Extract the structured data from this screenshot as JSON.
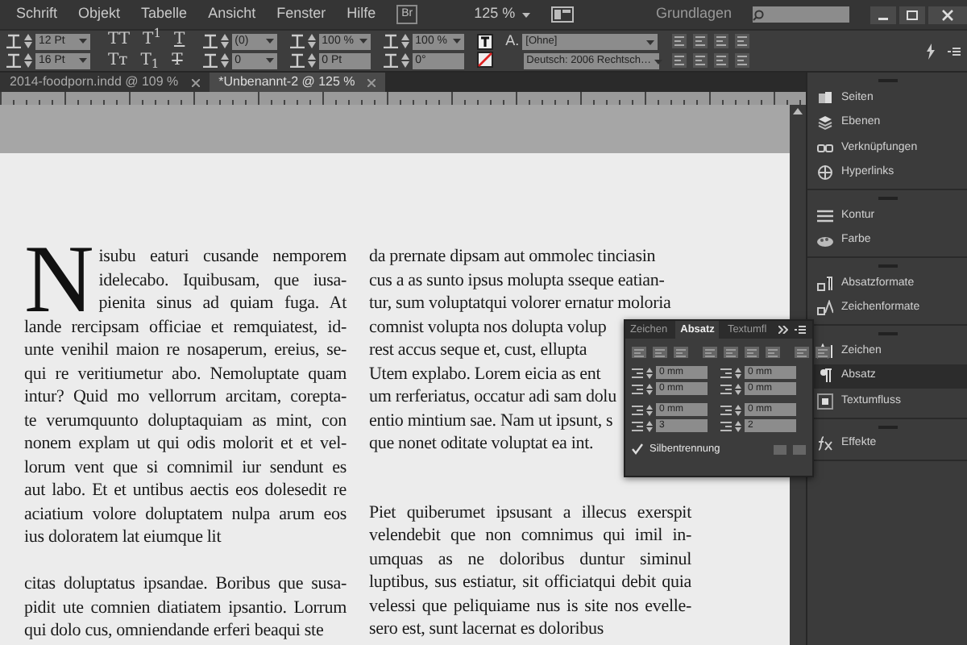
{
  "menu": [
    "Schrift",
    "Objekt",
    "Tabelle",
    "Ansicht",
    "Fenster",
    "Hilfe"
  ],
  "app_bar": {
    "bridge": "Br",
    "zoom": "125 %",
    "workspace": "Grundlagen"
  },
  "control_bar": {
    "size_fields": [
      {
        "value": "12 Pt",
        "dropdown": true
      },
      {
        "value": "16 Pt",
        "dropdown": true
      }
    ],
    "case_buttons": [
      {
        "text": "TT",
        "kind": "plain"
      },
      {
        "text": "T$^{1}$",
        "kind": "plain"
      },
      {
        "text": "T",
        "kind": "underline"
      },
      {
        "text": "Tᴛ",
        "kind": "plain"
      },
      {
        "text": "T$_{1}$",
        "kind": "plain"
      },
      {
        "text": "T",
        "kind": "strike"
      }
    ],
    "spacing_fields": [
      {
        "value": "(0)",
        "dropdown": true
      },
      {
        "value": "0",
        "dropdown": true
      }
    ],
    "scale_fields": [
      {
        "value": "100 %",
        "dropdown": true
      },
      {
        "value": "0 Pt",
        "dropdown": false
      }
    ],
    "skew_fields": [
      {
        "value": "100 %",
        "dropdown": true
      },
      {
        "value": "0°",
        "dropdown": false
      }
    ],
    "style_label": "A.",
    "style_menus": [
      "[Ohne]",
      "Deutsch: 2006 Rechtsch…"
    ]
  },
  "document_tabs": [
    {
      "label": "2014-foodporn.indd @ 109 %",
      "selected": false
    },
    {
      "label": "*Unbenannt-2 @ 125 %",
      "selected": true
    }
  ],
  "document": {
    "columns": [
      {
        "paragraphs": [
          {
            "drop_cap": "N",
            "justified": true,
            "lines": [
              "isubu eaturi cusande nemporem",
              "idelecabo. Iquibusam, que iusa-",
              "pienita sinus ad quiam fuga. At",
              "lande rercipsam officiae et remquiatest, id-",
              "unte venihil maion re nosaperum, ereius, se-",
              "qui re veritiumetur abo. Nemoluptate quam",
              "intur? Quid mo vellorrum arcitam, corepta-",
              "te verumquunto doluptaquiam as mint, con",
              "nonem explam ut qui odis molorit et et vel-",
              "lorum vent que si comnimil iur sendunt es",
              "aut labo. Et et untibus aectis eos dolesedit re",
              "aciatium volore doluptatem nulpa arum eos",
              "ius doloratem lat eiumque lit"
            ]
          },
          {
            "justified": true,
            "lines": [
              "citas doluptatus ipsandae. Boribus que susa-",
              "pidit ute comnien diatiatem ipsantio. Lorrum",
              "qui dolo cus, omniendande erferi beaqui ste"
            ]
          }
        ]
      },
      {
        "paragraphs": [
          {
            "justified": false,
            "lines": [
              "da prernate dipsam aut ommolec tinciasin",
              "cus a as sunto ipsus molupta sseque eatian-",
              "tur, sum voluptatqui volorer ernatur moloria",
              "comnist volupta nos dolupta volup",
              "rest accus seque et, cust, ellupta",
              "Utem explabo. Lorem eicia as ent",
              "um rerferiatus, occatur adi sam dolu",
              "entio mintium sae. Nam ut ipsunt, s",
              "que nonet oditate voluptat ea int."
            ]
          },
          {
            "justified": true,
            "lines": [
              "Piet quiberumet ipsusant a illecus exerspit",
              "velendebit que non comnimus qui imil in-",
              "umquas as ne doloribus duntur siminul",
              "luptibus, sus estiatur, sit officiatqui debit quia",
              "velessi que peliquiame nus is site nos evelle-",
              "sero est, sunt lacernat es doloribus"
            ]
          }
        ]
      }
    ]
  },
  "dock": {
    "groups": [
      {
        "items": [
          {
            "label": "Seiten",
            "kind": "pages",
            "selected": false
          },
          {
            "label": "Ebenen",
            "kind": "layers",
            "selected": false
          },
          {
            "label": "Verknüpfungen",
            "kind": "links",
            "selected": false
          },
          {
            "label": "Hyperlinks",
            "kind": "hyperlinks",
            "selected": false
          }
        ]
      },
      {
        "items": [
          {
            "label": "Kontur",
            "kind": "stroke",
            "selected": false
          },
          {
            "label": "Farbe",
            "kind": "color",
            "selected": false
          }
        ]
      },
      {
        "items": [
          {
            "label": "Absatzformate",
            "kind": "parastyle",
            "selected": false
          },
          {
            "label": "Zeichenformate",
            "kind": "charstyle",
            "selected": false
          }
        ]
      },
      {
        "items": [
          {
            "label": "Zeichen",
            "kind": "character",
            "selected": false
          },
          {
            "label": "Absatz",
            "kind": "paragraph",
            "selected": true
          },
          {
            "label": "Textumfluss",
            "kind": "wrap",
            "selected": false
          }
        ]
      },
      {
        "items": [
          {
            "label": "Effekte",
            "kind": "effects",
            "selected": false
          }
        ]
      }
    ]
  },
  "paragraph_panel": {
    "tabs": [
      {
        "label": "Zeichen",
        "selected": false
      },
      {
        "label": "Absatz",
        "selected": true
      },
      {
        "label": "Textumfl",
        "selected": false
      }
    ],
    "fields": [
      "0 mm",
      "0 mm",
      "0 mm",
      "0 mm",
      "0 mm",
      "0 mm",
      "3",
      "2"
    ],
    "hyphenation": {
      "label": "Silbentrennung",
      "checked": true
    }
  }
}
